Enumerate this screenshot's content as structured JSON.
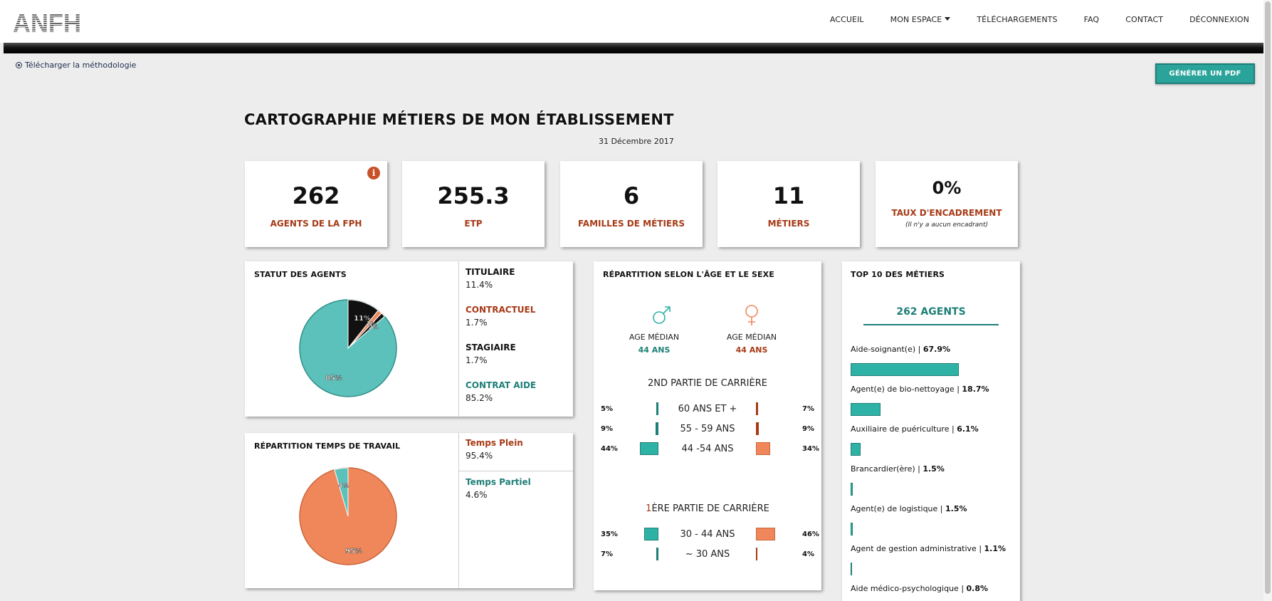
{
  "header": {
    "logo_text": "ANFH",
    "nav": [
      {
        "label": "ACCUEIL"
      },
      {
        "label": "MON ESPACE"
      },
      {
        "label": "TÉLÉCHARGEMENTS"
      },
      {
        "label": "FAQ"
      },
      {
        "label": "CONTACT"
      },
      {
        "label": "DÉCONNEXION"
      }
    ]
  },
  "methodology_link": "Télécharger la méthodologie",
  "pdf_button": "GÉNÉRER UN PDF",
  "page_title": "CARTOGRAPHIE MÉTIERS DE MON ÉTABLISSEMENT",
  "date": "31 Décembre 2017",
  "kpis": [
    {
      "value": "262",
      "label": "AGENTS DE LA FPH"
    },
    {
      "value": "255.3",
      "label": "ETP"
    },
    {
      "value": "6",
      "label": "FAMILLES DE MÉTIERS"
    },
    {
      "value": "11",
      "label": "MÉTIERS"
    },
    {
      "value": "0%",
      "label": "TAUX D'ENCADREMENT",
      "sub": "(Il n'y a aucun encadrant)"
    }
  ],
  "statut": {
    "title": "STATUT DES AGENTS",
    "legend": [
      {
        "label": "TITULAIRE",
        "value": "11.4%",
        "color": "#111111"
      },
      {
        "label": "CONTRACTUEL",
        "value": "1.7%",
        "color": "#a63a16"
      },
      {
        "label": "STAGIAIRE",
        "value": "1.7%",
        "color": "#111111"
      },
      {
        "label": "CONTRAT AIDE",
        "value": "85.2%",
        "color": "#1e7f77"
      }
    ],
    "pie_labels": [
      "11%",
      "2%",
      "2%",
      "85%"
    ]
  },
  "temps": {
    "title": "RÉPARTITION TEMPS DE TRAVAIL",
    "legend": [
      {
        "label": "Temps Plein",
        "value": "95.4%",
        "color": "#a63a16"
      },
      {
        "label": "Temps Partiel",
        "value": "4.6%",
        "color": "#1e7f77"
      }
    ],
    "pie_labels": [
      "4%",
      "95%"
    ]
  },
  "age_sexe": {
    "title": "RÉPARTITION SELON L'ÂGE ET LE SEXE",
    "male": {
      "label": "AGE MÉDIAN",
      "value": "44 ANS"
    },
    "female": {
      "label": "AGE MÉDIAN",
      "value": "44 ANS"
    },
    "second_title": "2ND PARTIE DE CARRIÈRE",
    "first_title_initial": "1",
    "first_title_rest": "ÈRE PARTIE DE CARRIÈRE",
    "rows_second": [
      {
        "group": "60 ANS ET +",
        "male": "5%",
        "female": "7%"
      },
      {
        "group": "55 - 59 ANS",
        "male": "9%",
        "female": "9%"
      },
      {
        "group": "44 -54 ANS",
        "male": "44%",
        "female": "34%"
      }
    ],
    "rows_first": [
      {
        "group": "30 - 44 ANS",
        "male": "35%",
        "female": "46%"
      },
      {
        "group": "~ 30 ANS",
        "male": "7%",
        "female": "4%"
      }
    ]
  },
  "top10": {
    "title": "TOP 10 DES MÉTIERS",
    "agents": "262 AGENTS",
    "items": [
      {
        "name": "Aide-soignant(e)",
        "value": "67.9%"
      },
      {
        "name": "Agent(e) de bio-nettoyage",
        "value": "18.7%"
      },
      {
        "name": "Auxiliaire de puériculture",
        "value": "6.1%"
      },
      {
        "name": "Brancardier(ère)",
        "value": "1.5%"
      },
      {
        "name": "Agent(e) de logistique",
        "value": "1.5%"
      },
      {
        "name": "Agent de gestion administrative",
        "value": "1.1%"
      },
      {
        "name": "Aide médico-psychologique",
        "value": "0.8%"
      }
    ]
  },
  "colors": {
    "teal": "#5dc1bb",
    "orange": "#f0875a",
    "dark_red": "#a63a16",
    "dark_teal": "#1e7f77"
  }
}
